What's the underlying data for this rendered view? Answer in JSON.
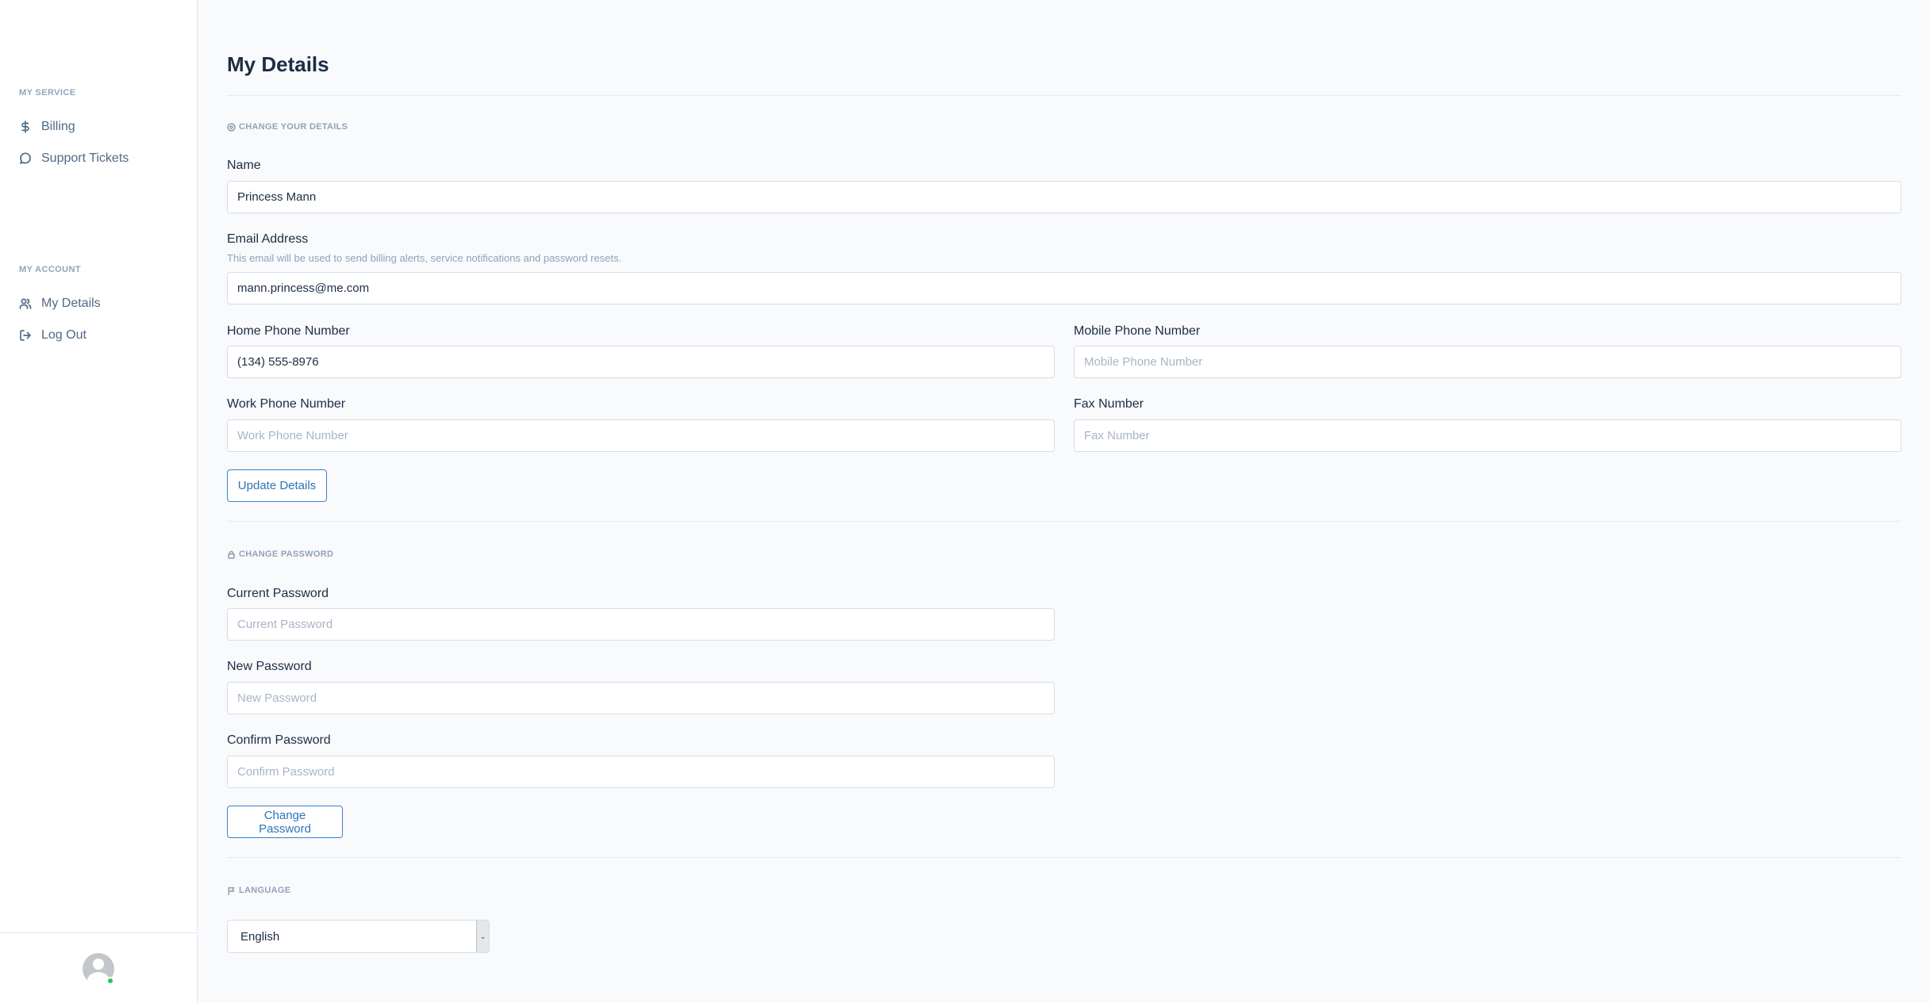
{
  "sidebar": {
    "sections": [
      {
        "title": "MY SERVICE",
        "items": [
          {
            "label": "Billing",
            "icon": "dollar-icon"
          },
          {
            "label": "Support Tickets",
            "icon": "chat-bubble-icon"
          }
        ]
      },
      {
        "title": "MY ACCOUNT",
        "items": [
          {
            "label": "My Details",
            "icon": "users-icon"
          },
          {
            "label": "Log Out",
            "icon": "logout-icon"
          }
        ]
      }
    ],
    "status_color": "#22c55e"
  },
  "page": {
    "title": "My Details"
  },
  "details": {
    "section_label": "CHANGE YOUR DETAILS",
    "name_label": "Name",
    "name_value": "Princess Mann",
    "email_label": "Email Address",
    "email_help": "This email will be used to send billing alerts, service notifications and password resets.",
    "email_value": "mann.princess@me.com",
    "home_phone_label": "Home Phone Number",
    "home_phone_value": "(134) 555-8976",
    "mobile_phone_label": "Mobile Phone Number",
    "mobile_phone_placeholder": "Mobile Phone Number",
    "work_phone_label": "Work Phone Number",
    "work_phone_placeholder": "Work Phone Number",
    "fax_label": "Fax Number",
    "fax_placeholder": "Fax Number",
    "update_button": "Update Details"
  },
  "password": {
    "section_label": "CHANGE PASSWORD",
    "current_label": "Current Password",
    "current_placeholder": "Current Password",
    "new_label": "New Password",
    "new_placeholder": "New Password",
    "confirm_label": "Confirm Password",
    "confirm_placeholder": "Confirm Password",
    "change_button": "Change Password"
  },
  "language": {
    "section_label": "LANGUAGE",
    "selected": "English"
  },
  "colors": {
    "accent": "#2f74b5",
    "background": "#f8fafc"
  }
}
